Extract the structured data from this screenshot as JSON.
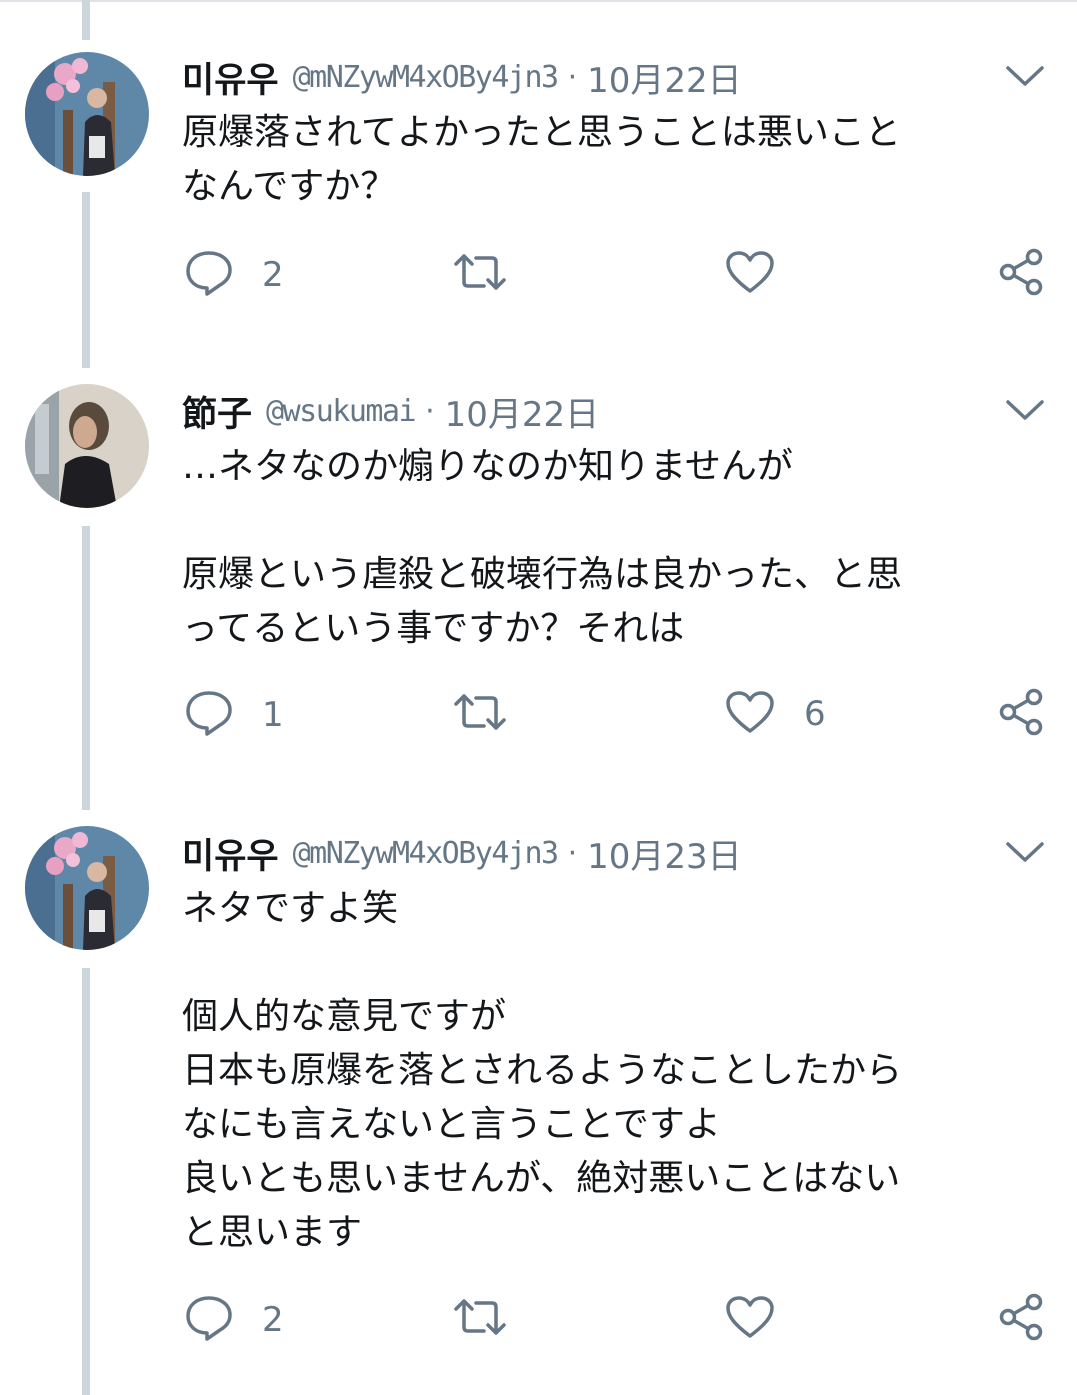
{
  "icons": {
    "more": "chevron-down-icon",
    "reply": "reply-icon",
    "retweet": "retweet-icon",
    "like": "heart-icon",
    "share": "share-icon"
  },
  "colors": {
    "text": "#14171a",
    "secondary": "#657786",
    "thread_line": "#ccd6dd"
  },
  "tweets": [
    {
      "name": "미유우",
      "handle": "@mNZywM4xOBy4jn3",
      "separator": "·",
      "date": "10月22日",
      "text": "原爆落されてよかったと思うことは悪いこと\nなんですか？",
      "reply_count": "2",
      "retweet_count": "",
      "like_count": ""
    },
    {
      "name": "節子",
      "handle": "@wsukumai",
      "separator": "·",
      "date": "10月22日",
      "text": "…ネタなのか煽りなのか知りませんが\n\n原爆という虐殺と破壊行為は良かった、と思\nってるという事ですか？それは",
      "reply_count": "1",
      "retweet_count": "",
      "like_count": "6"
    },
    {
      "name": "미유우",
      "handle": "@mNZywM4xOBy4jn3",
      "separator": "·",
      "date": "10月23日",
      "text": "ネタですよ笑\n\n個人的な意見ですが\n日本も原爆を落とされるようなことしたから\nなにも言えないと言うことですよ\n良いとも思いませんが、絶対悪いことはない\nと思います",
      "reply_count": "2",
      "retweet_count": "",
      "like_count": ""
    }
  ]
}
